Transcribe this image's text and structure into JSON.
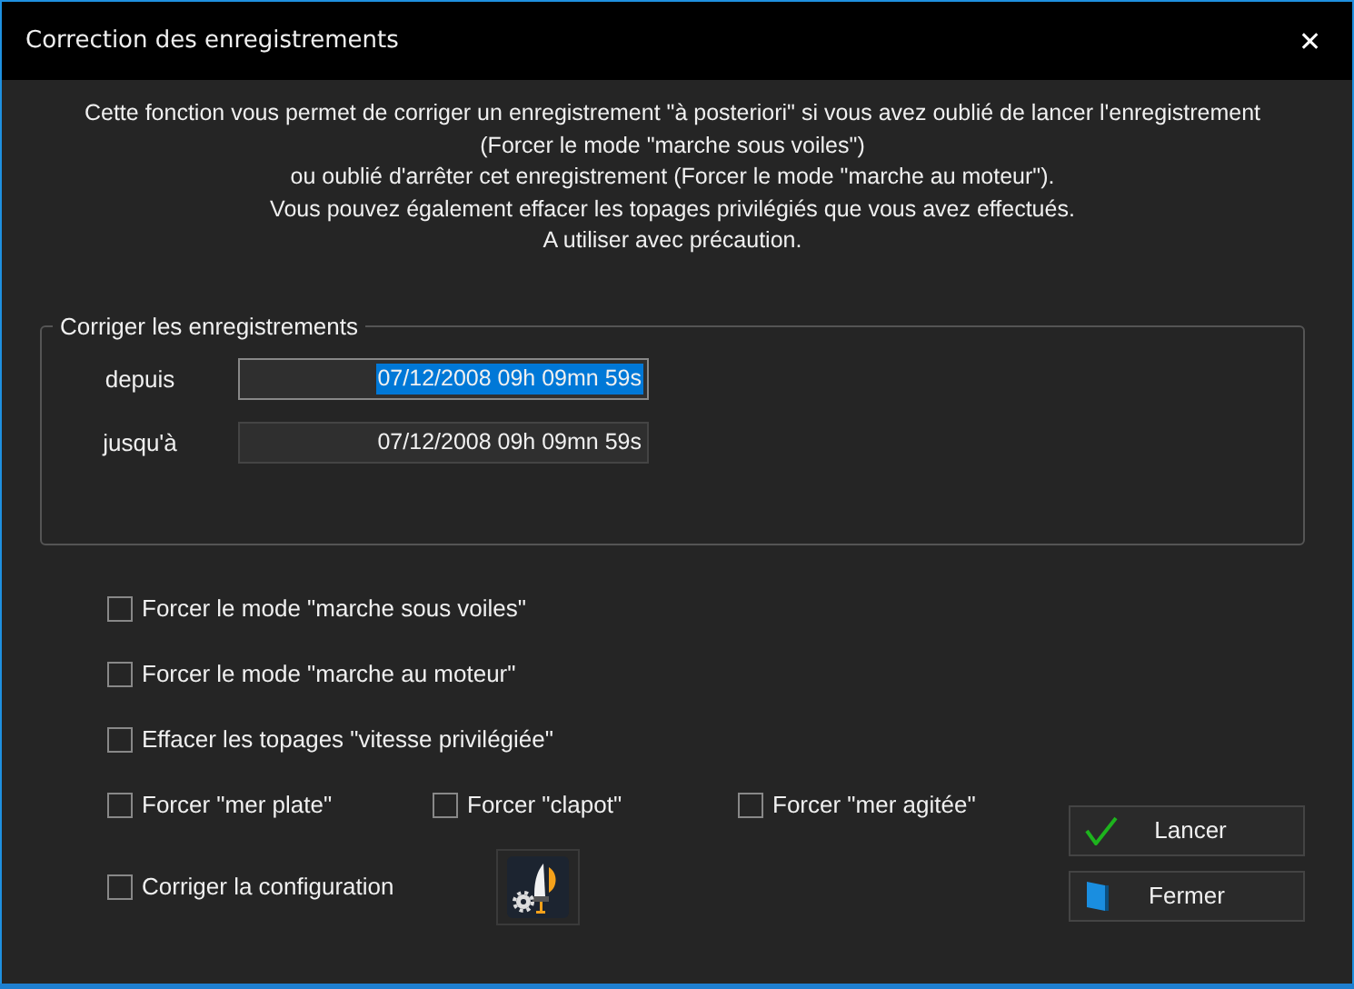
{
  "window": {
    "title": "Correction des enregistrements",
    "close": "✕"
  },
  "description": [
    "Cette fonction vous permet de corriger un enregistrement \"à posteriori\" si vous avez oublié de lancer l'enregistrement",
    "(Forcer le mode \"marche sous voiles\")",
    "ou oublié d'arrêter cet enregistrement (Forcer le mode \"marche au moteur\").",
    "Vous pouvez également effacer les topages privilégiés que vous avez effectués.",
    "A utiliser avec précaution."
  ],
  "group": {
    "title": "Corriger les enregistrements",
    "fields": [
      {
        "label": "depuis",
        "value": "07/12/2008 09h 09mn 59s",
        "selected": true
      },
      {
        "label": "jusqu'à",
        "value": "07/12/2008 09h 09mn 59s",
        "selected": false
      }
    ]
  },
  "options": [
    {
      "label": "Forcer le mode \"marche sous voiles\"",
      "checked": false
    },
    {
      "label": "Forcer le mode \"marche au moteur\"",
      "checked": false
    },
    {
      "label": "Effacer les topages \"vitesse privilégiée\"",
      "checked": false
    }
  ],
  "sea_state": [
    {
      "label": "Forcer \"mer plate\"",
      "checked": false
    },
    {
      "label": "Forcer \"clapot\"",
      "checked": false
    },
    {
      "label": "Forcer \"mer agitée\"",
      "checked": false
    }
  ],
  "config": {
    "label": "Corriger la configuration",
    "checked": false
  },
  "buttons": [
    {
      "label": "Lancer",
      "kind": "run"
    },
    {
      "label": "Fermer",
      "kind": "close"
    }
  ]
}
